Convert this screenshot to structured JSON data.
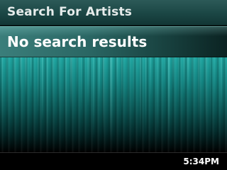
{
  "header": {
    "title": "Search For Artists"
  },
  "results": {
    "message": "No search results"
  },
  "status_bar": {
    "time": "5:34PM"
  },
  "colors": {
    "accent": "#1fa6a1",
    "header": "#1b4644",
    "text": "#ffffff"
  }
}
